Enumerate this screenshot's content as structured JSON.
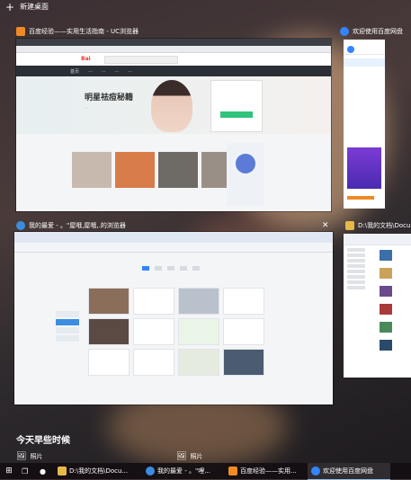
{
  "top": {
    "new_desktop": "新建桌面"
  },
  "windows": {
    "uc": {
      "title": "百度经验——实用生活指南 - UC浏览器",
      "banner_title": "明星祛痘秘籍",
      "banner_sub": "...",
      "nav": [
        "首页",
        "...",
        "...",
        "...",
        "..."
      ]
    },
    "pan": {
      "title": "欢迎使用百度网盘"
    },
    "qh": {
      "title": "我的最爱 - 。\"屋哦,屋哦,.的浏览器"
    },
    "explorer": {
      "title": "D:\\我的文档\\Docume"
    }
  },
  "timeline": {
    "heading": "今天早些时候",
    "photo1": "照片",
    "photo2": "照片"
  },
  "taskbar": {
    "items": [
      {
        "label": "D:\\我的文档\\Docu..."
      },
      {
        "label": "我的最爱 - 。\"哩..."
      },
      {
        "label": "百度经验——实用..."
      },
      {
        "label": "欢迎使用百度网盘"
      }
    ]
  },
  "colors": {
    "uc_orange": "#f08a24",
    "baidu_blue": "#3385ff",
    "taskbar": "#140e12"
  }
}
